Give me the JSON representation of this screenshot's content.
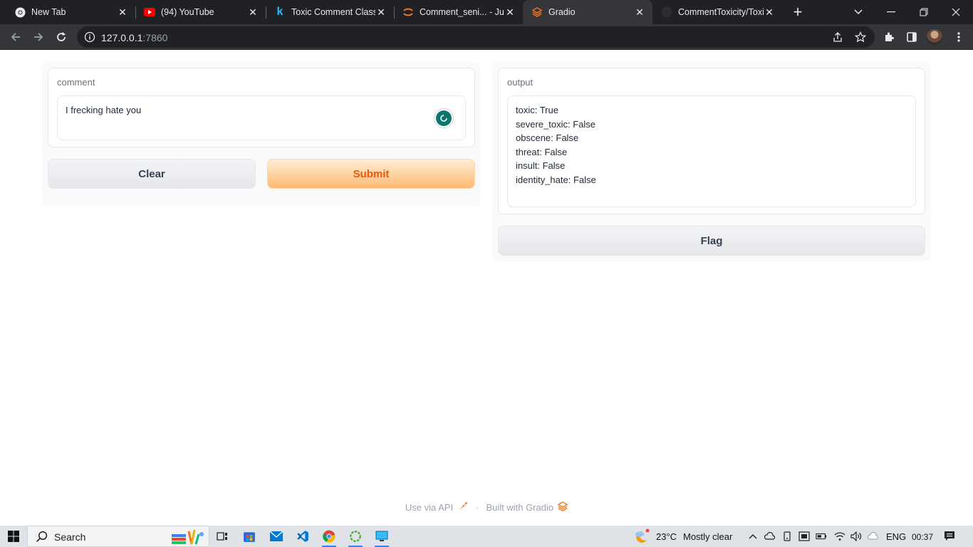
{
  "browser": {
    "tabs": [
      {
        "title": "New Tab",
        "icon": "chrome-icon",
        "active": false
      },
      {
        "title": "(94) YouTube",
        "icon": "youtube-icon",
        "active": false
      },
      {
        "title": "Toxic Comment Classif",
        "icon": "kaggle-icon",
        "active": false
      },
      {
        "title": "Comment_seni... - Jup",
        "icon": "jupyter-icon",
        "active": false
      },
      {
        "title": "Gradio",
        "icon": "gradio-icon",
        "active": true
      },
      {
        "title": "CommentToxicity/Toxi",
        "icon": "github-icon",
        "active": false
      }
    ],
    "url_host": "127.0.0.1",
    "url_port": ":7860"
  },
  "app": {
    "input_label": "comment",
    "input_value": "I frecking hate you",
    "clear_label": "Clear",
    "submit_label": "Submit",
    "output_label": "output",
    "output_lines": [
      "toxic: True",
      "severe_toxic: False",
      "obscene: False",
      "threat: False",
      "insult: False",
      "identity_hate: False"
    ],
    "flag_label": "Flag",
    "footer_api": "Use via API",
    "footer_sep": "·",
    "footer_built": "Built with Gradio"
  },
  "taskbar": {
    "search_label": "Search",
    "temperature": "23°C",
    "weather": "Mostly clear",
    "language": "ENG",
    "time": "00:37"
  },
  "colors": {
    "accent": "#ea580c",
    "chrome_dark": "#202124",
    "chrome_active": "#35363a"
  }
}
